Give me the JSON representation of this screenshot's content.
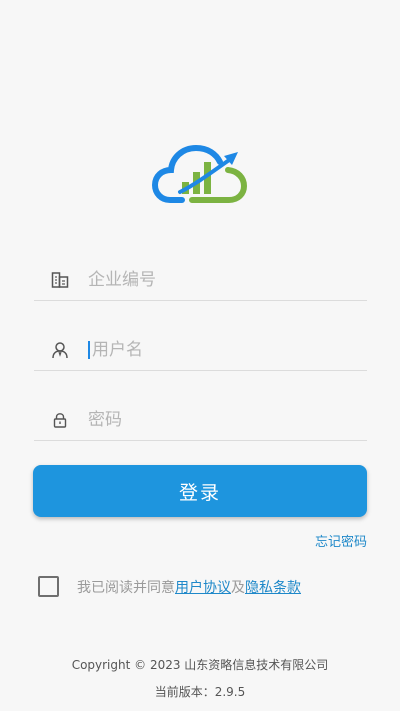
{
  "login": {
    "company_placeholder": "企业编号",
    "username_placeholder": "用户名",
    "password_placeholder": "密码",
    "login_button": "登录",
    "forgot_password": "忘记密码"
  },
  "agreement": {
    "prefix": "我已阅读并同意",
    "user_agreement": "用户协议",
    "connector": "及",
    "privacy_terms": "隐私条款"
  },
  "footer": {
    "copyright": "Copyright © 2023 山东资略信息技术有限公司",
    "version": "当前版本：2.9.5"
  },
  "colors": {
    "primary": "#1e95de",
    "link": "#1e88c9",
    "logo_blue": "#1e88e5",
    "logo_green": "#7cb342"
  },
  "icons": {
    "logo": "cloud-chart-logo",
    "company": "building-icon",
    "user": "user-icon",
    "password": "lock-icon"
  }
}
